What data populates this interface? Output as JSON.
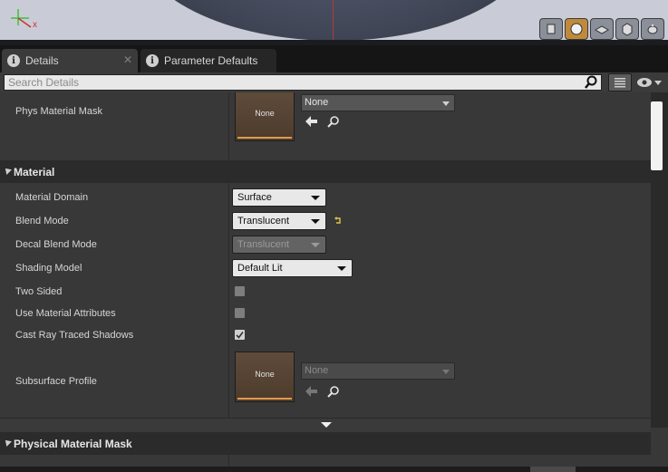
{
  "viewport": {
    "axis_label_x": "x",
    "buttons": [
      "cylinder-preview-icon",
      "sphere-preview-icon",
      "plane-preview-icon",
      "cube-preview-icon",
      "teapot-preview-icon"
    ],
    "active_button": "sphere-preview-icon"
  },
  "tabs": [
    {
      "label": "Details",
      "active": true
    },
    {
      "label": "Parameter Defaults",
      "active": false
    }
  ],
  "search": {
    "placeholder": "Search Details"
  },
  "phys_material_mask_row": {
    "label": "Phys Material Mask",
    "thumbnail": "None",
    "combo_value": "None"
  },
  "material_section": {
    "title": "Material",
    "rows": [
      {
        "label": "Material Domain",
        "value": "Surface"
      },
      {
        "label": "Blend Mode",
        "value": "Translucent"
      },
      {
        "label": "Decal Blend Mode",
        "value": "Translucent"
      },
      {
        "label": "Shading Model",
        "value": "Default Lit"
      },
      {
        "label": "Two Sided",
        "checked": false
      },
      {
        "label": "Use Material Attributes",
        "checked": false
      },
      {
        "label": "Cast Ray Traced Shadows",
        "checked": true
      }
    ],
    "subsurface": {
      "label": "Subsurface Profile",
      "thumbnail": "None",
      "combo_value": "None"
    }
  },
  "physical_material_mask_section": {
    "title": "Physical Material Mask"
  },
  "colors": {
    "panel_bg": "#383838",
    "accent_orange": "#e39a4d",
    "reset_arrow": "#e5c24a"
  }
}
